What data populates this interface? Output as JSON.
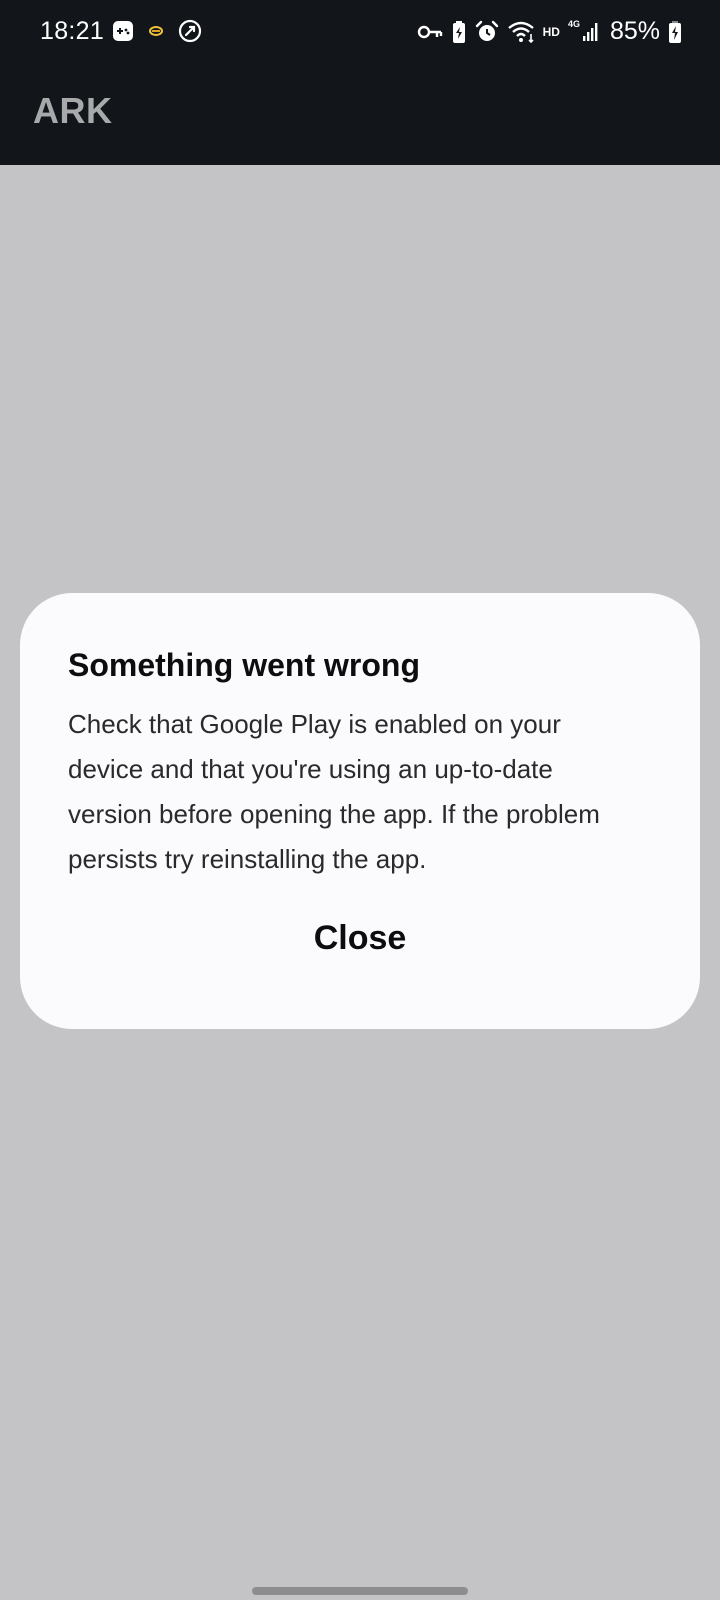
{
  "status_bar": {
    "time": "18:21",
    "network_label": "HD",
    "network_type": "4G",
    "battery_percent": "85%",
    "left_icons": [
      "game-controller-icon",
      "notification-dot-icon",
      "rocket-icon"
    ],
    "right_icons": [
      "vpn-key-icon",
      "battery-saver-icon",
      "alarm-icon",
      "wifi-icon",
      "signal-icon",
      "battery-charging-icon"
    ]
  },
  "app_bar": {
    "title": "ARK"
  },
  "dialog": {
    "title": "Something went wrong",
    "message": "Check that Google Play is enabled on your device and that you're using an up-to-date version before opening the app. If the problem persists try reinstalling the app.",
    "close_label": "Close"
  },
  "colors": {
    "status_bar_bg": "#12161a",
    "scrim": "#c4c4c6",
    "dialog_bg": "#fbfbfd",
    "app_title": "#a7a9ab"
  }
}
